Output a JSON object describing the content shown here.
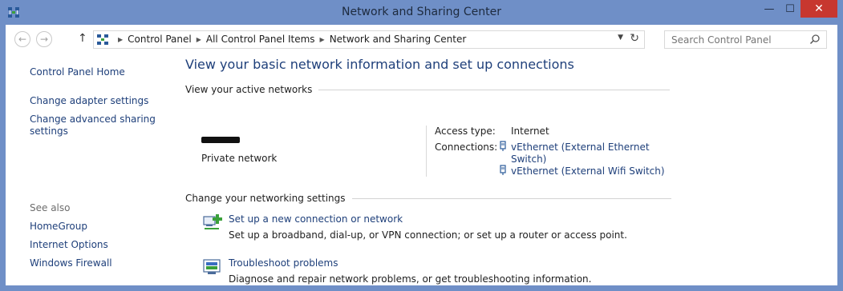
{
  "window": {
    "title": "Network and Sharing Center",
    "icon": "network-icon",
    "controls": {
      "minimize": "—",
      "maximize": "☐",
      "close": "✕"
    }
  },
  "address_bar": {
    "breadcrumbs": [
      "Control Panel",
      "All Control Panel Items",
      "Network and Sharing Center"
    ]
  },
  "search": {
    "placeholder": "Search Control Panel"
  },
  "left_nav": {
    "home": "Control Panel Home",
    "links": [
      "Change adapter settings",
      "Change advanced sharing settings"
    ],
    "see_also_label": "See also",
    "see_also": [
      "HomeGroup",
      "Internet Options",
      "Windows Firewall"
    ]
  },
  "main": {
    "heading": "View your basic network information and set up connections",
    "active_networks_label": "View your active networks",
    "network": {
      "category": "Private network",
      "access_type_label": "Access type:",
      "access_type_value": "Internet",
      "connections_label": "Connections:",
      "connections": [
        {
          "line1": "vEthernet (External Ethernet",
          "line2": "Switch)"
        },
        {
          "line1": "vEthernet (External Wifi Switch)"
        }
      ]
    },
    "change_settings_label": "Change your networking settings",
    "tasks": [
      {
        "title": "Set up a new connection or network",
        "description": "Set up a broadband, dial-up, or VPN connection; or set up a router or access point.",
        "icon": "new-connection-icon"
      },
      {
        "title": "Troubleshoot problems",
        "description": "Diagnose and repair network problems, or get troubleshooting information.",
        "icon": "troubleshoot-icon"
      }
    ]
  },
  "colors": {
    "title_bar": "#6f8fc7",
    "close_button": "#c7372f",
    "link": "#1e3f7a",
    "heading": "#1e3f7a"
  }
}
